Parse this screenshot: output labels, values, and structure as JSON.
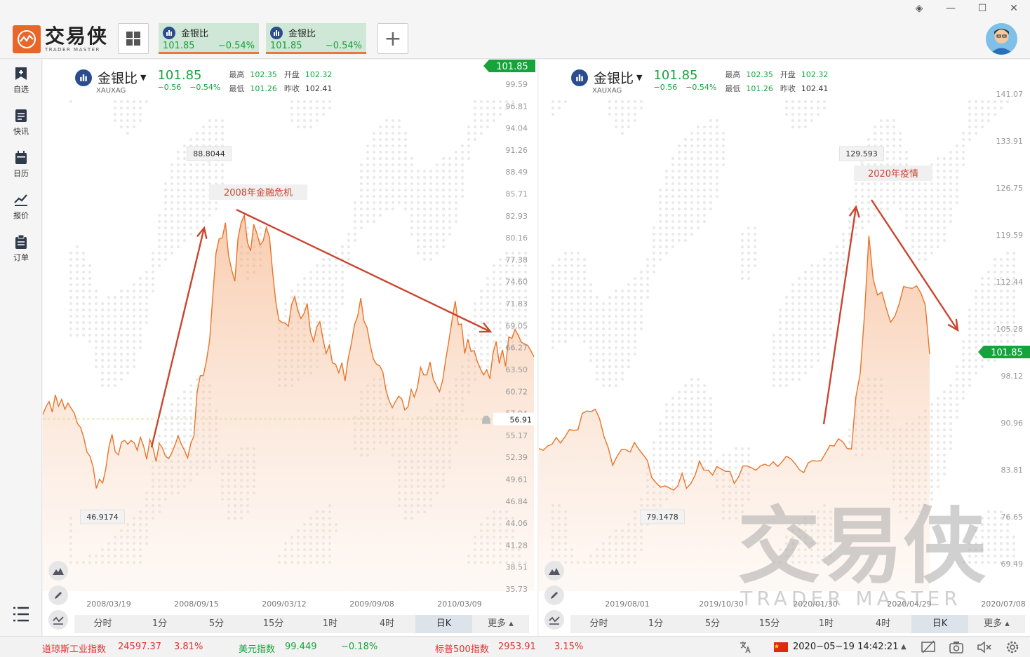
{
  "app": {
    "name_cn": "交易侠",
    "name_en": "TRADER MASTER"
  },
  "tabs": [
    {
      "name": "金银比",
      "price": "101.85",
      "change": "−0.54%"
    },
    {
      "name": "金银比",
      "price": "101.85",
      "change": "−0.54%"
    }
  ],
  "add_tab_label": "+",
  "sidebar": [
    {
      "label": "自选",
      "icon": "bookmark-plus-icon"
    },
    {
      "label": "快讯",
      "icon": "news-icon"
    },
    {
      "label": "日历",
      "icon": "calendar-icon"
    },
    {
      "label": "报价",
      "icon": "quote-chart-icon"
    },
    {
      "label": "订单",
      "icon": "order-clipboard-icon"
    }
  ],
  "colors": {
    "up": "#17a33b",
    "down": "#e0322e",
    "line": "#e8742a",
    "accent": "#e8662a",
    "annotation": "#c9452f"
  },
  "timeframes": [
    "分时",
    "1分",
    "5分",
    "15分",
    "1时",
    "4时",
    "日K",
    "更多 ▴"
  ],
  "active_timeframe": "日K",
  "left_panel": {
    "header": {
      "name": "金银比",
      "symbol": "XAUXAG",
      "price": "101.85",
      "change": "−0.56",
      "change_pct": "−0.54%",
      "high_label": "最高",
      "high": "102.35",
      "open_label": "开盘",
      "open": "102.32",
      "low_label": "最低",
      "low": "101.26",
      "prev_label": "昨收",
      "prev": "102.41"
    },
    "price_tag": "101.85",
    "alert_line_value": "56.91",
    "annotation": "2008年金融危机",
    "high_marker": "88.8044",
    "low_marker": "46.9174"
  },
  "right_panel": {
    "header": {
      "name": "金银比",
      "symbol": "XAUXAG",
      "price": "101.85",
      "change": "−0.56",
      "change_pct": "−0.54%",
      "high_label": "最高",
      "high": "102.35",
      "open_label": "开盘",
      "open": "102.32",
      "low_label": "最低",
      "low": "101.26",
      "prev_label": "昨收",
      "prev": "102.41"
    },
    "price_tag": "101.85",
    "annotation": "2020年疫情",
    "high_marker": "129.593",
    "low_marker": "79.1478",
    "watermark_cn": "交易侠",
    "watermark_en": "TRADER MASTER"
  },
  "chart_data": [
    {
      "type": "line",
      "title": "",
      "ylim": [
        34.3,
        101.0
      ],
      "y_ticks": [
        "99.59",
        "96.81",
        "94.04",
        "91.26",
        "88.49",
        "85.71",
        "82.93",
        "80.16",
        "77.38",
        "74.60",
        "71.83",
        "69.05",
        "66.27",
        "63.50",
        "60.72",
        "57.94",
        "55.17",
        "52.39",
        "49.61",
        "46.84",
        "44.06",
        "41.28",
        "38.51",
        "35.73"
      ],
      "x_ticks": [
        "2008/03/19",
        "2008/09/15",
        "2009/03/12",
        "2009/09/08",
        "2010/03/09"
      ],
      "values": [
        57.5,
        58.5,
        59.2,
        57.8,
        60.1,
        58.6,
        59.5,
        58.2,
        59.0,
        58.3,
        57.7,
        56.3,
        55.8,
        54.5,
        52.6,
        52.0,
        50.6,
        47.8,
        49.0,
        48.5,
        50.3,
        53.2,
        54.9,
        52.6,
        52.2,
        53.9,
        54.1,
        53.6,
        54.1,
        53.8,
        52.8,
        54.5,
        53.4,
        51.6,
        54.2,
        53.1,
        51.3,
        53.7,
        53.1,
        52.0,
        51.7,
        52.5,
        53.5,
        54.7,
        53.6,
        52.8,
        51.8,
        53.7,
        54.7,
        60.4,
        62.6,
        62.6,
        64.6,
        67.3,
        73.1,
        78.7,
        80.6,
        80.7,
        82.7,
        78.4,
        76.5,
        75.0,
        80.7,
        82.7,
        83.7,
        80.1,
        79.0,
        82.5,
        81.3,
        79.8,
        80.3,
        82.1,
        80.8,
        76.2,
        72.3,
        69.9,
        69.6,
        69.5,
        69.1,
        71.9,
        73.0,
        71.2,
        70.1,
        70.8,
        72.1,
        68.4,
        67.1,
        69.0,
        69.7,
        67.4,
        65.5,
        66.6,
        64.3,
        64.1,
        63.0,
        64.3,
        61.9,
        64.9,
        66.8,
        69.3,
        70.4,
        72.8,
        69.8,
        68.9,
        66.6,
        64.8,
        64.1,
        63.9,
        63.1,
        60.7,
        59.3,
        58.4,
        59.2,
        59.9,
        59.6,
        58.1,
        58.5,
        60.8,
        59.8,
        61.1,
        63.7,
        62.7,
        62.7,
        64.4,
        62.2,
        61.3,
        60.5,
        62.0,
        64.8,
        67.2,
        69.9,
        72.4,
        69.3,
        69.4,
        65.5,
        67.4,
        65.8,
        65.9,
        64.5,
        63.5,
        62.7,
        63.4,
        62.2,
        65.6,
        67.1,
        64.2,
        66.0,
        63.8,
        67.7,
        67.5,
        68.7,
        67.9,
        67.0,
        66.8,
        66.6,
        65.9,
        65.1
      ]
    },
    {
      "type": "line",
      "title": "",
      "ylim": [
        65.0,
        149.0
      ],
      "y_ticks": [
        "141.07",
        "133.91",
        "126.75",
        "119.59",
        "112.44",
        "105.28",
        "98.12",
        "90.96",
        "83.81",
        "76.65",
        "69.49"
      ],
      "x_ticks": [
        "2019/08/01",
        "2019/10/30",
        "2020/01/30",
        "2020/04/29",
        "2020/07/08"
      ],
      "values": [
        88.6,
        88.3,
        89.0,
        89.3,
        90.4,
        89.5,
        90.5,
        91.7,
        91.6,
        91.7,
        94.4,
        94.8,
        94.7,
        95.1,
        93.5,
        90.6,
        88.7,
        85.8,
        87.3,
        88.4,
        88.4,
        88.0,
        89.6,
        88.5,
        87.6,
        86.6,
        83.8,
        82.9,
        82.2,
        82.4,
        82.1,
        81.7,
        82.4,
        84.5,
        82.0,
        82.8,
        84.2,
        86.5,
        85.0,
        85.0,
        84.2,
        85.6,
        85.2,
        84.8,
        84.8,
        82.8,
        83.9,
        85.7,
        85.7,
        85.4,
        85.0,
        85.7,
        86.0,
        85.7,
        86.4,
        85.6,
        86.4,
        87.3,
        86.9,
        86.1,
        85.1,
        84.6,
        86.2,
        86.6,
        86.5,
        86.6,
        87.8,
        89.1,
        89.0,
        90.2,
        89.7,
        88.6,
        88.5,
        97.1,
        101.0,
        110.9,
        123.8,
        116.6,
        114.0,
        114.5,
        111.8,
        109.5,
        110.5,
        112.6,
        115.4,
        115.2,
        115.1,
        115.5,
        114.3,
        112.3,
        104.2
      ]
    }
  ]
}
